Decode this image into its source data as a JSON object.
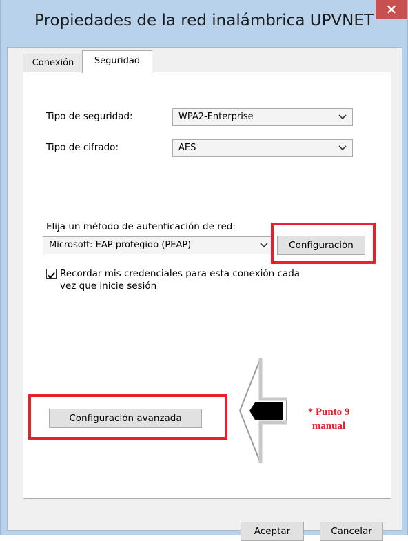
{
  "window": {
    "title": "Propiedades de la red inalámbrica UPVNET",
    "close_glyph": "×"
  },
  "tabs": [
    {
      "label": "Conexión",
      "selected": false
    },
    {
      "label": "Seguridad",
      "selected": true
    }
  ],
  "security": {
    "type_label": "Tipo de seguridad:",
    "type_value": "WPA2-Enterprise",
    "cipher_label": "Tipo de cifrado:",
    "cipher_value": "AES",
    "auth_label": "Elija un método de autenticación de red:",
    "auth_value": "Microsoft: EAP protegido (PEAP)",
    "config_button": "Configuración",
    "remember_checked": true,
    "remember_line1": "Recordar mis credenciales para esta conexión cada",
    "remember_line2": "vez que inicie sesión",
    "advanced_button": "Configuración avanzada"
  },
  "annotation": {
    "line1": "* Punto 9",
    "line2": "manual",
    "color": "#e8202a"
  },
  "footer": {
    "ok_button": "Aceptar",
    "cancel_button": "Cancelar"
  },
  "icons": {
    "dropdown": "chevron-down-icon",
    "check": "checkmark-icon",
    "arrow": "arrow-left-icon"
  }
}
